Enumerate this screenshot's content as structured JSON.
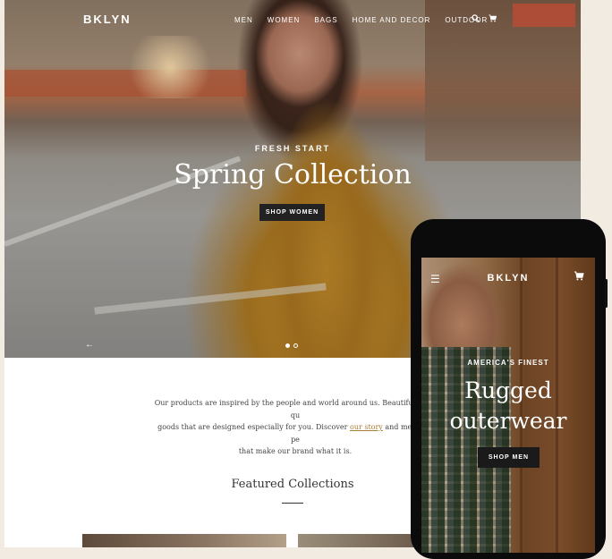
{
  "desktop": {
    "logo": "BKLYN",
    "menu": [
      "MEN",
      "WOMEN",
      "BAGS",
      "HOME AND DECOR",
      "OUTDOOR"
    ],
    "icons": [
      "search-icon",
      "cart-icon"
    ],
    "hero": {
      "subtitle": "FRESH START",
      "title": "Spring Collection",
      "button": "SHOP WOMEN",
      "prev_arrow": "←",
      "slides": 2,
      "active_slide": 1
    },
    "about": {
      "line1": "Our products are inspired by the people and world around us. Beautiful, high qu",
      "line2_before": "goods that are designed especially for you. Discover ",
      "line2_link": "our story",
      "line2_after": " and meet the pe",
      "line3": "that make our brand what it is."
    },
    "featured_title": "Featured Collections"
  },
  "mobile": {
    "logo": "BKLYN",
    "menu_icon": "☰",
    "cart_icon": "🛒",
    "subtitle": "AMERICA'S FINEST",
    "title_line1": "Rugged",
    "title_line2": "outerwear",
    "button": "SHOP MEN"
  },
  "colors": {
    "background": "#f2ebe1",
    "button": "#222222",
    "link": "#a97e36"
  }
}
